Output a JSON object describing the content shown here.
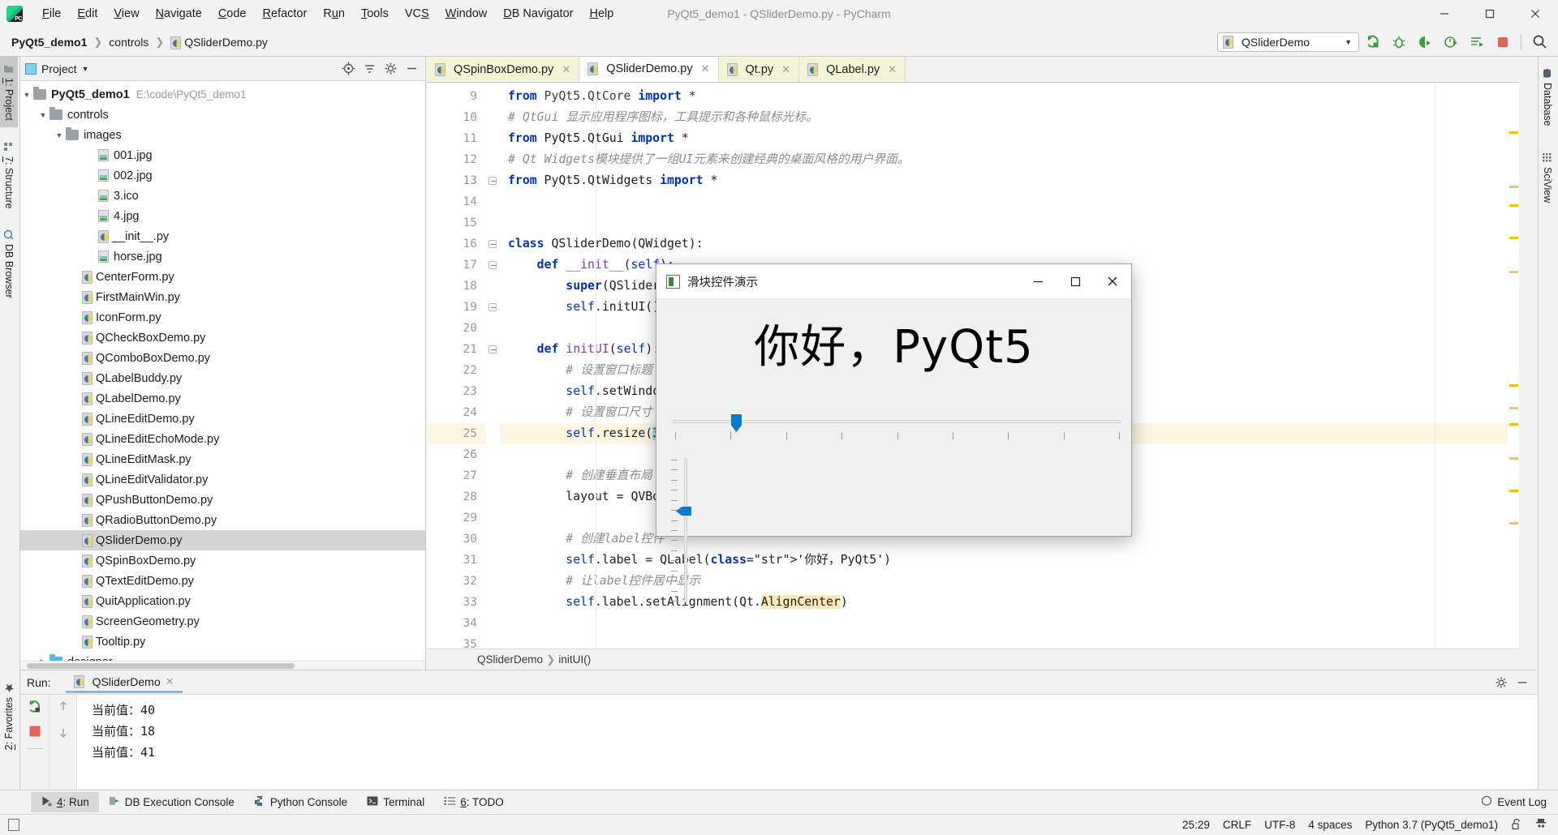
{
  "window": {
    "title": "PyQt5_demo1 - QSliderDemo.py - PyCharm",
    "minimize": "─",
    "maximize": "☐",
    "close": "✕"
  },
  "menubar": {
    "items": [
      {
        "label": "File",
        "mnemonic": "F"
      },
      {
        "label": "Edit",
        "mnemonic": "E"
      },
      {
        "label": "View",
        "mnemonic": "V"
      },
      {
        "label": "Navigate",
        "mnemonic": "N"
      },
      {
        "label": "Code",
        "mnemonic": "C"
      },
      {
        "label": "Refactor",
        "mnemonic": "R"
      },
      {
        "label": "Run",
        "mnemonic": "u"
      },
      {
        "label": "Tools",
        "mnemonic": "T"
      },
      {
        "label": "VCS",
        "mnemonic": "S"
      },
      {
        "label": "Window",
        "mnemonic": "W"
      },
      {
        "label": "DB Navigator",
        "mnemonic": "D"
      },
      {
        "label": "Help",
        "mnemonic": "H"
      }
    ]
  },
  "navbar": {
    "breadcrumbs": [
      "PyQt5_demo1",
      "controls",
      "QSliderDemo.py"
    ],
    "run_config": "QSliderDemo",
    "toolbar_icons": [
      "run-icon",
      "debug-icon",
      "coverage-icon",
      "profile-icon",
      "run-with-console-icon",
      "stop-icon",
      "search-everywhere-icon"
    ]
  },
  "left_strip": {
    "tabs": [
      {
        "label": "1: Project",
        "mnemonic": "1",
        "icon": "project-folder-icon",
        "active": true
      },
      {
        "label": "7: Structure",
        "mnemonic": "7",
        "icon": "structure-icon",
        "active": false
      },
      {
        "label": "DB Browser",
        "mnemonic": "D",
        "icon": "db-browser-icon",
        "active": false
      }
    ],
    "bottom_tabs": [
      {
        "label": "2: Favorites",
        "mnemonic": "2",
        "icon": "star-icon"
      }
    ]
  },
  "right_strip": {
    "tabs": [
      {
        "label": "Database",
        "icon": "database-icon"
      },
      {
        "label": "SciView",
        "icon": "sciview-icon"
      }
    ]
  },
  "project_panel": {
    "title": "Project",
    "header_icons": [
      "target-icon",
      "collapse-all-icon",
      "settings-icon",
      "hide-icon"
    ],
    "tree": [
      {
        "label": "PyQt5_demo1",
        "path": "E:\\code\\PyQt5_demo1",
        "indent": 0,
        "type": "folder",
        "arrow": "open",
        "bold": true
      },
      {
        "label": "controls",
        "path": "",
        "indent": 1,
        "type": "folder",
        "arrow": "open",
        "bold": false
      },
      {
        "label": "images",
        "path": "",
        "indent": 2,
        "type": "folder",
        "arrow": "open",
        "bold": false
      },
      {
        "label": "001.jpg",
        "path": "",
        "indent": 4,
        "type": "image",
        "arrow": "",
        "bold": false
      },
      {
        "label": "002.jpg",
        "path": "",
        "indent": 4,
        "type": "image",
        "arrow": "",
        "bold": false
      },
      {
        "label": "3.ico",
        "path": "",
        "indent": 4,
        "type": "image",
        "arrow": "",
        "bold": false
      },
      {
        "label": "4.jpg",
        "path": "",
        "indent": 4,
        "type": "image",
        "arrow": "",
        "bold": false
      },
      {
        "label": "__init__.py",
        "path": "",
        "indent": 4,
        "type": "python",
        "arrow": "",
        "bold": false
      },
      {
        "label": "horse.jpg",
        "path": "",
        "indent": 4,
        "type": "image",
        "arrow": "",
        "bold": false
      },
      {
        "label": "CenterForm.py",
        "path": "",
        "indent": 3,
        "type": "python",
        "arrow": "",
        "bold": false
      },
      {
        "label": "FirstMainWin.py",
        "path": "",
        "indent": 3,
        "type": "python",
        "arrow": "",
        "bold": false
      },
      {
        "label": "IconForm.py",
        "path": "",
        "indent": 3,
        "type": "python",
        "arrow": "",
        "bold": false
      },
      {
        "label": "QCheckBoxDemo.py",
        "path": "",
        "indent": 3,
        "type": "python",
        "arrow": "",
        "bold": false
      },
      {
        "label": "QComboBoxDemo.py",
        "path": "",
        "indent": 3,
        "type": "python",
        "arrow": "",
        "bold": false
      },
      {
        "label": "QLabelBuddy.py",
        "path": "",
        "indent": 3,
        "type": "python",
        "arrow": "",
        "bold": false
      },
      {
        "label": "QLabelDemo.py",
        "path": "",
        "indent": 3,
        "type": "python",
        "arrow": "",
        "bold": false
      },
      {
        "label": "QLineEditDemo.py",
        "path": "",
        "indent": 3,
        "type": "python",
        "arrow": "",
        "bold": false
      },
      {
        "label": "QLineEditEchoMode.py",
        "path": "",
        "indent": 3,
        "type": "python",
        "arrow": "",
        "bold": false
      },
      {
        "label": "QLineEditMask.py",
        "path": "",
        "indent": 3,
        "type": "python",
        "arrow": "",
        "bold": false
      },
      {
        "label": "QLineEditValidator.py",
        "path": "",
        "indent": 3,
        "type": "python",
        "arrow": "",
        "bold": false
      },
      {
        "label": "QPushButtonDemo.py",
        "path": "",
        "indent": 3,
        "type": "python",
        "arrow": "",
        "bold": false
      },
      {
        "label": "QRadioButtonDemo.py",
        "path": "",
        "indent": 3,
        "type": "python",
        "arrow": "",
        "bold": false
      },
      {
        "label": "QSliderDemo.py",
        "path": "",
        "indent": 3,
        "type": "python",
        "arrow": "",
        "bold": false,
        "selected": true
      },
      {
        "label": "QSpinBoxDemo.py",
        "path": "",
        "indent": 3,
        "type": "python",
        "arrow": "",
        "bold": false
      },
      {
        "label": "QTextEditDemo.py",
        "path": "",
        "indent": 3,
        "type": "python",
        "arrow": "",
        "bold": false
      },
      {
        "label": "QuitApplication.py",
        "path": "",
        "indent": 3,
        "type": "python",
        "arrow": "",
        "bold": false
      },
      {
        "label": "ScreenGeometry.py",
        "path": "",
        "indent": 3,
        "type": "python",
        "arrow": "",
        "bold": false
      },
      {
        "label": "Tooltip.py",
        "path": "",
        "indent": 3,
        "type": "python",
        "arrow": "",
        "bold": false
      },
      {
        "label": "designer",
        "path": "",
        "indent": 1,
        "type": "folder-blue",
        "arrow": "closed",
        "bold": false
      }
    ]
  },
  "editor": {
    "tabs": [
      {
        "label": "QSpinBoxDemo.py",
        "active": false
      },
      {
        "label": "QSliderDemo.py",
        "active": true
      },
      {
        "label": "Qt.py",
        "active": false
      },
      {
        "label": "QLabel.py",
        "active": false
      }
    ],
    "first_line_number": 9,
    "lines": [
      {
        "n": 9,
        "text": "from PyQt5.QtCore import *",
        "clipped": true
      },
      {
        "n": 10,
        "text": "# QtGui 显示应用程序图标，工具提示和各种鼠标光标。"
      },
      {
        "n": 11,
        "text": "from PyQt5.QtGui import *"
      },
      {
        "n": 12,
        "text": "# Qt Widgets模块提供了一组UI元素来创建经典的桌面风格的用户界面。"
      },
      {
        "n": 13,
        "text": "from PyQt5.QtWidgets import *"
      },
      {
        "n": 14,
        "text": ""
      },
      {
        "n": 15,
        "text": ""
      },
      {
        "n": 16,
        "text": "class QSliderDemo(QWidget):"
      },
      {
        "n": 17,
        "text": "    def __init__(self):"
      },
      {
        "n": 18,
        "text": "        super(QSliderDemo, self).__init__()"
      },
      {
        "n": 19,
        "text": "        self.initUI()"
      },
      {
        "n": 20,
        "text": ""
      },
      {
        "n": 21,
        "text": "    def initUI(self):"
      },
      {
        "n": 22,
        "text": "        # 设置窗口标题"
      },
      {
        "n": 23,
        "text": "        self.setWindowTitle('滑块控件演示')"
      },
      {
        "n": 24,
        "text": "        # 设置窗口尺寸"
      },
      {
        "n": 25,
        "text": "        self.resize(300, 200)",
        "highlight": true
      },
      {
        "n": 26,
        "text": ""
      },
      {
        "n": 27,
        "text": "        # 创建垂直布局"
      },
      {
        "n": 28,
        "text": "        layout = QVBoxLayout()"
      },
      {
        "n": 29,
        "text": ""
      },
      {
        "n": 30,
        "text": "        # 创建label控件"
      },
      {
        "n": 31,
        "text": "        self.label = QLabel('你好，PyQt5')"
      },
      {
        "n": 32,
        "text": "        # 让label控件居中显示"
      },
      {
        "n": 33,
        "text": "        self.label.setAlignment(Qt.AlignCenter)"
      },
      {
        "n": 34,
        "text": ""
      },
      {
        "n": 35,
        "text": ""
      }
    ],
    "breadcrumbs": [
      "QSliderDemo",
      "initUI()"
    ]
  },
  "popup": {
    "title": "滑块控件演示",
    "label": "你好，PyQt5",
    "minimize": "─",
    "maximize": "☐",
    "close": "✕",
    "hslider": {
      "value": 15,
      "min": 0,
      "max": 100,
      "tick_count": 9
    },
    "vslider": {
      "value": 41,
      "min": 0,
      "max": 100,
      "tick_count": 15
    }
  },
  "run_panel": {
    "run_label": "Run:",
    "tab_label": "QSliderDemo",
    "console_lines": [
      "当前值：40",
      "当前值：18",
      "当前值：41"
    ],
    "tool_icons": [
      "rerun-icon",
      "stop-icon",
      "up-arrow-icon",
      "down-arrow-icon"
    ],
    "header_icons": [
      "settings-gear-icon",
      "hide-icon"
    ]
  },
  "bottom_bar": {
    "tabs": [
      {
        "label": "4: Run",
        "mnemonic": "4",
        "icon": "run-icon",
        "active": true
      },
      {
        "label": "DB Execution Console",
        "mnemonic": "",
        "icon": "db-console-icon",
        "active": false
      },
      {
        "label": "Python Console",
        "mnemonic": "",
        "icon": "python-icon",
        "active": false
      },
      {
        "label": "Terminal",
        "mnemonic": "",
        "icon": "terminal-icon",
        "active": false
      },
      {
        "label": "6: TODO",
        "mnemonic": "6",
        "icon": "todo-list-icon",
        "active": false
      }
    ],
    "event_log": "Event Log"
  },
  "status_bar": {
    "caret": "25:29",
    "line_separator": "CRLF",
    "encoding": "UTF-8",
    "indent": "4 spaces",
    "interpreter": "Python 3.7 (PyQt5_demo1)",
    "icons": [
      "lock-open-icon",
      "inspector-icon"
    ]
  },
  "colors": {
    "accent_blue": "#0a7ad0",
    "keyword": "#0033b3",
    "string": "#067d17",
    "comment": "#8c8c8c",
    "function": "#7a3e9d",
    "highlight_line": "#fdf6e3",
    "selection": "#a6e3e9",
    "identifier_highlight": "#fae8b8"
  }
}
